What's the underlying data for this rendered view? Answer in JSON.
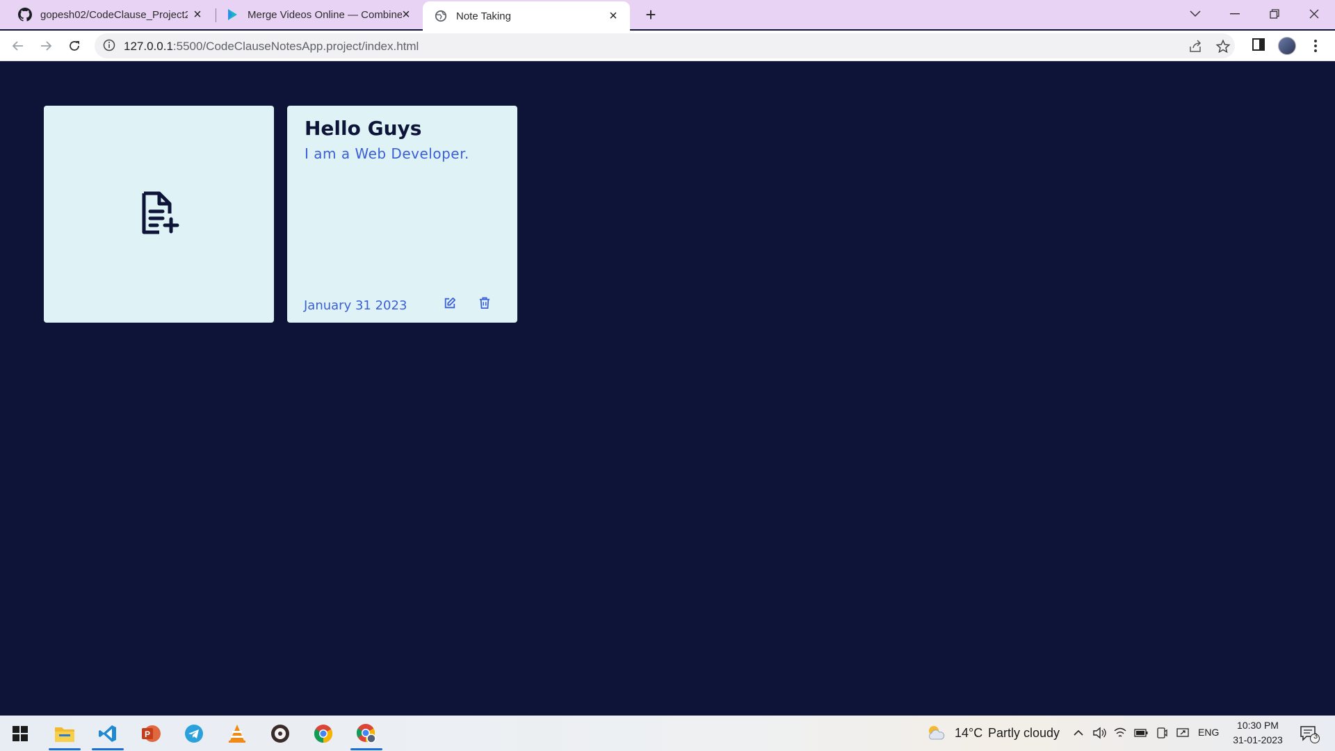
{
  "browser": {
    "tabs": [
      {
        "title": "gopesh02/CodeClause_Project2",
        "icon": "github-icon"
      },
      {
        "title": "Merge Videos Online — Combine",
        "icon": "play-icon"
      },
      {
        "title": "Note Taking",
        "icon": "globe-icon",
        "active": true
      }
    ],
    "url_host": "127.0.0.1",
    "url_rest": ":5500/CodeClauseNotesApp.project/index.html"
  },
  "app": {
    "add_note_icon": "file-plus-icon",
    "notes": [
      {
        "title": "Hello Guys",
        "body": "I am a Web Developer.",
        "date": "January 31 2023"
      }
    ]
  },
  "colors": {
    "page_bg": "#0e1438",
    "card_bg": "#dff2f6",
    "accent": "#3a5fd6",
    "tabbar_bg": "#e9d3f5"
  },
  "taskbar": {
    "weather_temp": "14°C",
    "weather_desc": "Partly cloudy",
    "language": "ENG",
    "time": "10:30 PM",
    "date": "31-01-2023",
    "notification_count": "3",
    "apps": [
      "windows-start-icon",
      "file-explorer-icon",
      "vscode-icon",
      "powerpoint-icon",
      "telegram-icon",
      "vlc-icon",
      "music-player-icon",
      "chrome-icon",
      "chrome-profile-icon"
    ]
  }
}
